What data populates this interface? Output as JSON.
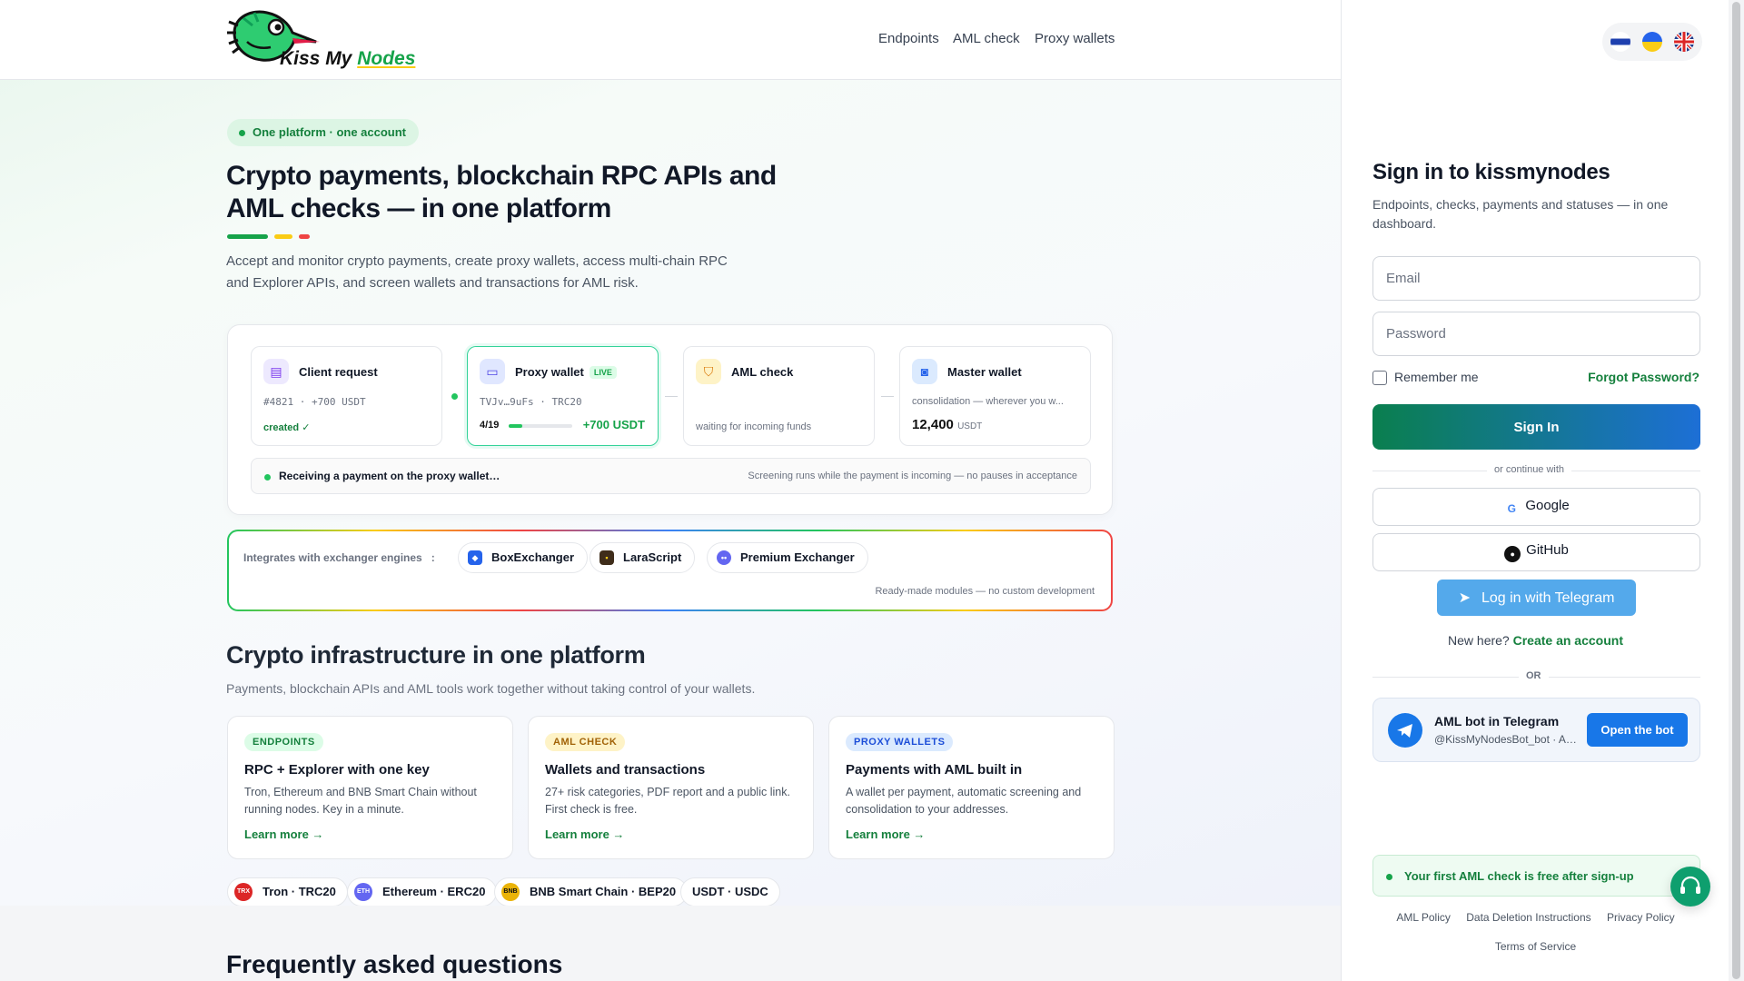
{
  "brand": {
    "logo_text_a": "Kiss My ",
    "logo_text_b": "Nodes"
  },
  "nav": [
    "Endpoints",
    "AML check",
    "Proxy wallets"
  ],
  "hero": {
    "badge": "One platform · one account",
    "title": "Crypto payments, blockchain RPC APIs and AML checks — in one platform",
    "lead": "Accept and monitor crypto payments, create proxy wallets, access multi-chain RPC and Explorer APIs, and screen wallets and transactions for AML risk."
  },
  "flow": {
    "steps": [
      {
        "title": "Client request",
        "sub": "#4821 · +700 USDT",
        "extra": "created ✓"
      },
      {
        "title": "Proxy wallet",
        "tag": "LIVE",
        "sub": "TVJv…9uFs · TRC20",
        "progress_label": "4/19",
        "progress": 0.21,
        "amount": "+700 USDT"
      },
      {
        "title": "AML check",
        "extra": "waiting for incoming funds"
      },
      {
        "title": "Master wallet",
        "sub": "consolidation — wherever you w...",
        "amount": "12,400",
        "unit": "USDT"
      }
    ],
    "status_left": "Receiving a payment on the proxy wallet…",
    "status_right": "Screening runs while the payment is incoming — no pauses in acceptance"
  },
  "integrations": {
    "label": "Integrates with exchanger engines",
    "sep": ":",
    "items": [
      "BoxExchanger",
      "LaraScript",
      "Premium Exchanger"
    ],
    "footnote": "Ready-made modules — no custom development"
  },
  "infra": {
    "title": "Crypto infrastructure in one platform",
    "subtitle": "Payments, blockchain APIs and AML tools work together without taking control of your wallets.",
    "cards": [
      {
        "tag": "ENDPOINTS",
        "title": "RPC + Explorer with one key",
        "desc": "Tron, Ethereum and BNB Smart Chain without running nodes. Key in a minute.",
        "link": "Learn more →"
      },
      {
        "tag": "AML CHECK",
        "title": "Wallets and transactions",
        "desc": "27+ risk categories, PDF report and a public link. First check is free.",
        "link": "Learn more →"
      },
      {
        "tag": "PROXY WALLETS",
        "title": "Payments with AML built in",
        "desc": "A wallet per payment, automatic screening and consolidation to your addresses.",
        "link": "Learn more →"
      }
    ],
    "networks": [
      {
        "icon": "TRX",
        "label": "Tron · TRC20"
      },
      {
        "icon": "ETH",
        "label": "Ethereum · ERC20"
      },
      {
        "icon": "BNB",
        "label": "BNB Smart Chain · BEP20"
      },
      {
        "label": "USDT · USDC"
      }
    ]
  },
  "faq": {
    "title": "Frequently asked questions"
  },
  "auth": {
    "title": "Sign in to kissmynodes",
    "subtitle": "Endpoints, checks, payments and statuses — in one dashboard.",
    "email_placeholder": "Email",
    "password_placeholder": "Password",
    "remember": "Remember me",
    "forgot": "Forgot Password?",
    "signin": "Sign In",
    "or_continue": "or continue with",
    "google": "Google",
    "github": "GitHub",
    "telegram": "Log in with Telegram",
    "new_here": "New here?",
    "create_account": "Create an account",
    "or": "OR",
    "bot_title": "AML bot in Telegram",
    "bot_handle": "@KissMyNodesBot_bot · AML checks",
    "bot_button": "Open the bot",
    "free_banner": "Your first AML check is free after sign-up",
    "footer": [
      "AML Policy",
      "Data Deletion Instructions",
      "Privacy Policy"
    ],
    "footer2": "Terms of Service"
  },
  "colors": {
    "accent_green": "#15803d",
    "telegram_blue": "#54a9eb",
    "bot_blue": "#1877e8"
  }
}
